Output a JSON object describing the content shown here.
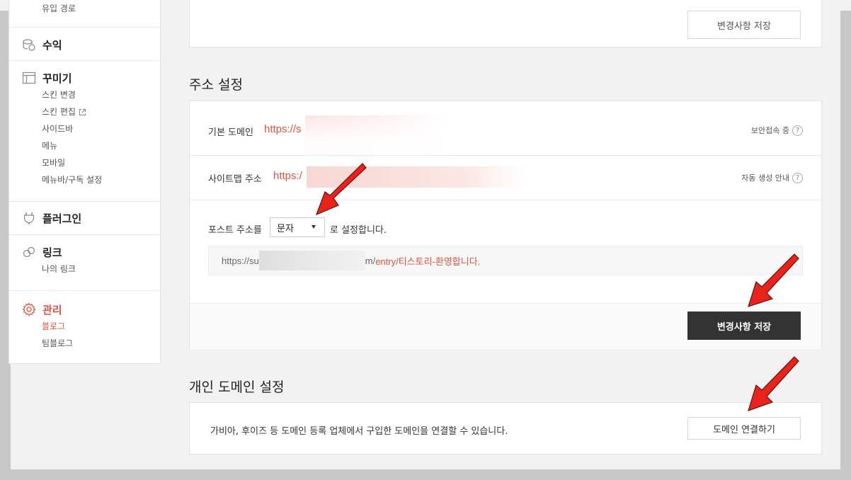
{
  "sidebar": {
    "top_item": "유입 경로",
    "revenue": {
      "label": "수익",
      "icon": "coins-icon"
    },
    "decorate": {
      "label": "꾸미기",
      "icon": "layout-icon",
      "items": [
        "스킨 변경",
        "스킨 편집",
        "사이드바",
        "메뉴",
        "모바일",
        "메뉴바/구독 설정"
      ]
    },
    "plugin": {
      "label": "플러그인",
      "icon": "plug-icon"
    },
    "link": {
      "label": "링크",
      "icon": "link-icon",
      "items": [
        "나의 링크"
      ]
    },
    "manage": {
      "label": "관리",
      "icon": "gear-icon",
      "items": [
        "블로그",
        "팀블로그"
      ]
    }
  },
  "top_card": {
    "save_label": "변경사항 저장"
  },
  "address": {
    "title": "주소 설정",
    "default_domain_label": "기본 도메인",
    "default_domain_value": "https://s",
    "secure_label": "보안접속 중",
    "sitemap_label": "사이트맵 주소",
    "sitemap_value": "https:/",
    "sitemap_help": "자동 생성 안내",
    "post_prefix": "포스트 주소를",
    "post_select_value": "문자",
    "post_suffix": "로 설정합니다.",
    "preview_start": "https://su",
    "preview_mid": "m/",
    "preview_path": "entry/티스토리-환영합니다.",
    "save_label": "변경사항 저장"
  },
  "custom_domain": {
    "title": "개인 도메인 설정",
    "description": "가비아, 후이즈 등 도메인 등록 업체에서 구입한 도메인을 연결할 수 있습니다.",
    "connect_label": "도메인 연결하기"
  },
  "colors": {
    "accent": "#e0533f",
    "dark_button": "#333333",
    "arrow": "#e8231b"
  }
}
